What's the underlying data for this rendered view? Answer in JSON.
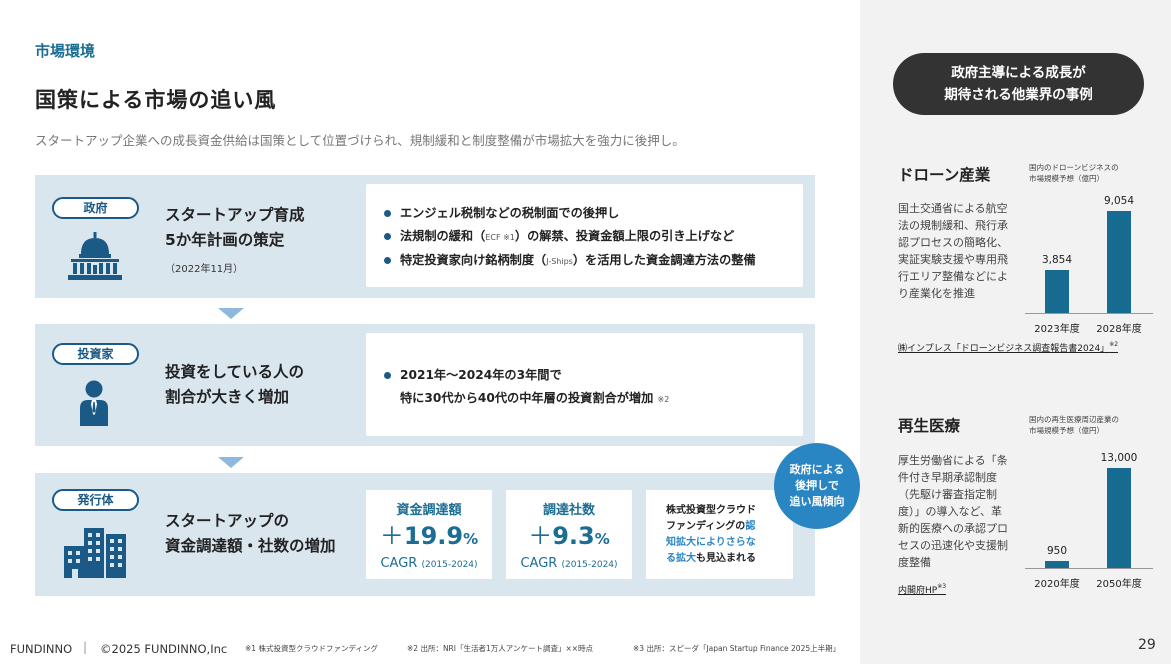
{
  "header": {
    "section_label": "市場環境",
    "title": "国策による市場の追い風",
    "subtitle": "スタートアップ企業への成長資金供給は国策として位置づけられ、規制緩和と制度整備が市場拡大を強力に後押し。"
  },
  "government": {
    "tag": "政府",
    "icon": "government-building-icon",
    "title_line1": "スタートアップ育成",
    "title_line2": "5か年計画の策定",
    "date": "（2022年11月）",
    "bullets": [
      {
        "text": "エンジェル税制などの税制面での後押し"
      },
      {
        "text_a": "法規制の緩和（",
        "note_a": "ECF ※1",
        "text_b": "）の解禁、投資金額上限の引き上げなど"
      },
      {
        "text_a": "特定投資家向け銘柄制度（",
        "note_a": "J-Ships",
        "text_b": "）を活用した資金調達方法の整備"
      }
    ]
  },
  "investor": {
    "tag": "投資家",
    "icon": "person-icon",
    "title_line1": "投資をしている人の",
    "title_line2": "割合が大きく増加",
    "bullet_line1": "2021年〜2024年の3年間で",
    "bullet_line2": "特に30代から40代の中年層の投資割合が増加",
    "bullet_note": "※2"
  },
  "issuer": {
    "tag": "発行体",
    "icon": "office-buildings-icon",
    "title_line1": "スタートアップの",
    "title_line2": "資金調達額・社数の増加",
    "metrics": [
      {
        "label": "資金調達額",
        "sign": "＋",
        "value": "19.9",
        "unit": "%",
        "sub": "CAGR",
        "period": "(2015-2024)"
      },
      {
        "label": "調達社数",
        "sign": "＋",
        "value": "9.3",
        "unit": "%",
        "sub": "CAGR",
        "period": "(2015-2024)"
      }
    ],
    "crowd_lines": [
      {
        "plain": "株式投資型クラウド",
        "hl": ""
      },
      {
        "plain": "ファンディングの",
        "hl": "認"
      },
      {
        "plain": "",
        "hl": "知拡大によりさらな"
      },
      {
        "plain_after": "も見込まれる",
        "hl": "る拡大"
      }
    ]
  },
  "bubble": {
    "line1": "政府による",
    "line2": "後押しで",
    "line3": "追い風傾向"
  },
  "sidebar": {
    "pill_line1": "政府主導による成長が",
    "pill_line2": "期待される他業界の事例",
    "drone": {
      "title": "ドローン産業",
      "caption_line1": "国内のドローンビジネスの",
      "caption_line2": "市場規模予想（億円）",
      "description": "国土交通省による航空法の規制緩和、飛行承認プロセスの簡略化、実証実験支援や専用飛行エリア整備などにより産業化を推進",
      "source": "㈱インプレス「ドローンビジネス調査報告書2024」",
      "source_note": "※2"
    },
    "regen": {
      "title": "再生医療",
      "caption_line1": "国内の再生医療周辺産業の",
      "caption_line2": "市場規模予想（億円）",
      "description": "厚生労働省による「条件付き早期承認制度（先駆け審査指定制度）」の導入など、革新的医療への承認プロセスの迅速化や支援制度整備",
      "source": "内閣府HP",
      "source_note": "※3"
    }
  },
  "chart_data": [
    {
      "type": "bar",
      "title": "国内のドローンビジネスの市場規模予想（億円）",
      "categories": [
        "2023年度",
        "2028年度"
      ],
      "values": [
        3854,
        9054
      ],
      "value_labels": [
        "3,854",
        "9,054"
      ],
      "color": "#176b91"
    },
    {
      "type": "bar",
      "title": "国内の再生医療周辺産業の市場規模予想（億円）",
      "categories": [
        "2020年度",
        "2050年度"
      ],
      "values": [
        950,
        13000
      ],
      "value_labels": [
        "950",
        "13,000"
      ],
      "color": "#176b91"
    }
  ],
  "footer": {
    "brand": "FUNDINNO",
    "separator": "|",
    "copyright": "©2025 FUNDINNO,Inc",
    "note1": "※1 株式投資型クラウドファンディング",
    "note2": "※2 出所：NRI「生活者1万人アンケート調査」××時点",
    "note3": "※3 出所：スピーダ「Japan Startup Finance 2025上半期」",
    "page": "29"
  },
  "colors": {
    "accent": "#1b6d94",
    "band": "#dae6ee",
    "bar": "#176b91",
    "bubble": "#2a86c2",
    "sidebar_bg": "#f2f2f2"
  }
}
